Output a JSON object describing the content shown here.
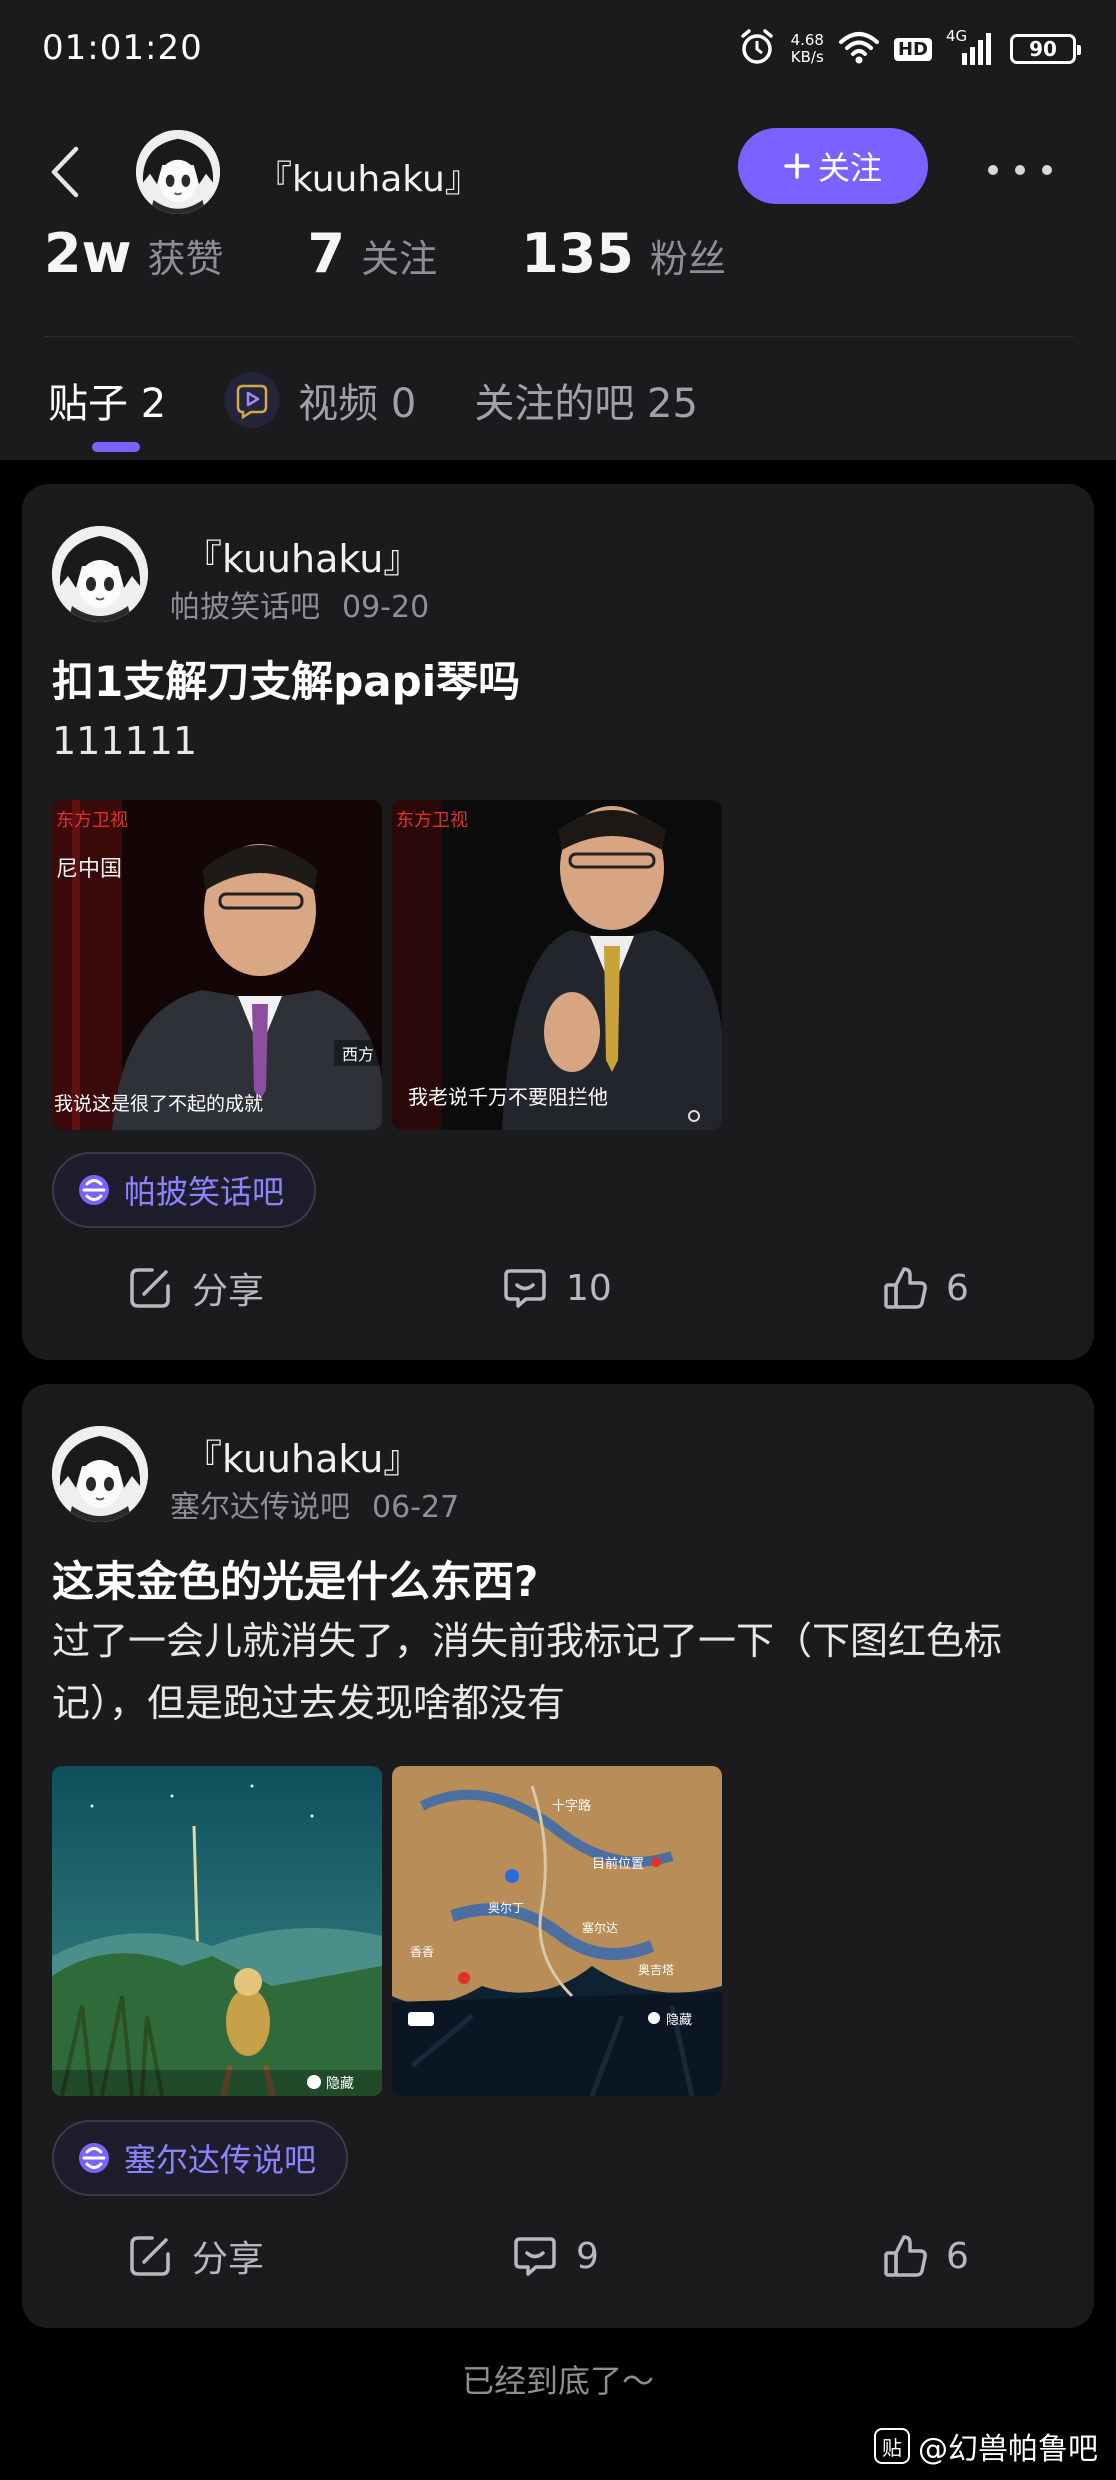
{
  "status_bar": {
    "time": "01:01:20",
    "net_speed_value": "4.68",
    "net_speed_unit": "KB/s",
    "hd_label": "HD",
    "network_label": "4G",
    "battery_level": "90"
  },
  "profile": {
    "name": "『kuuhaku』",
    "follow_label": "关注",
    "stats": [
      {
        "value": "2w",
        "label": "获赞"
      },
      {
        "value": "7",
        "label": "关注"
      },
      {
        "value": "135",
        "label": "粉丝"
      }
    ]
  },
  "tabs": [
    {
      "label": "贴子 2"
    },
    {
      "label": "视频 0"
    },
    {
      "label": "关注的吧 25"
    }
  ],
  "posts": [
    {
      "author": "『kuuhaku』",
      "forum": "帕披笑话吧",
      "date": "09-20",
      "title": "扣1支解刀支解papi琴吗",
      "body": "111111",
      "images": [
        {
          "channel_logo": "东方卫视",
          "overlay": "尼中国",
          "corner_text": "西方",
          "caption": "我说这是很了不起的成就"
        },
        {
          "channel_logo": "东方卫视",
          "caption": "我老说千万不要阻拦他"
        }
      ],
      "tag": "帕披笑话吧",
      "share_label": "分享",
      "comments": "10",
      "likes": "6"
    },
    {
      "author": "『kuuhaku』",
      "forum": "塞尔达传说吧",
      "date": "06-27",
      "title": "这束金色的光是什么东西?",
      "body": "过了一会儿就消失了，消失前我标记了一下（下图红色标记），但是跑过去发现啥都没有",
      "images": [
        {
          "corner_text": "隐藏"
        },
        {
          "map_label_1": "十字路",
          "map_label_2": "目前位置",
          "map_label_3": "奥尔丁",
          "map_label_4": "塞尔达",
          "map_label_5": "香香",
          "map_label_6": "奥吉塔",
          "corner_text": "隐藏"
        }
      ],
      "tag": "塞尔达传说吧",
      "share_label": "分享",
      "comments": "9",
      "likes": "6"
    }
  ],
  "footer": {
    "end_text": "已经到底了〜",
    "watermark_icon": "贴",
    "watermark": "@幻兽帕鲁吧"
  },
  "colors": {
    "accent": "#7b61ff",
    "background": "#000000",
    "card": "#1b1b1d",
    "muted_text": "#8e8e93"
  }
}
